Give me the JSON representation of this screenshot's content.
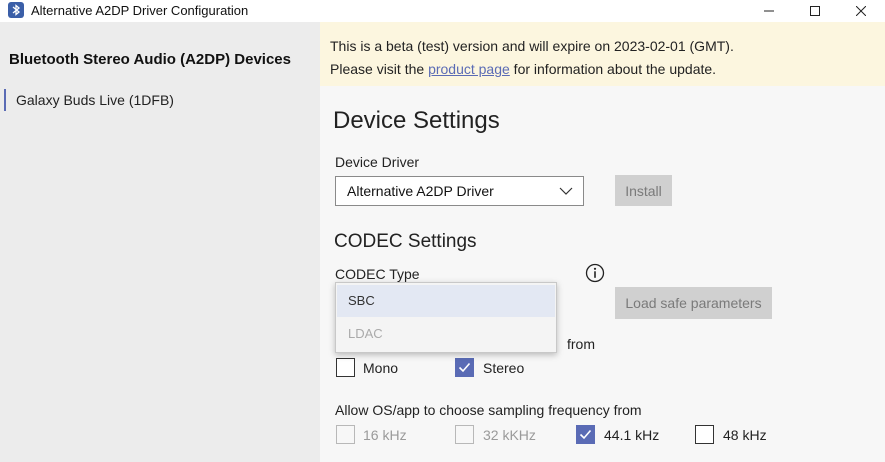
{
  "window": {
    "title": "Alternative A2DP Driver Configuration"
  },
  "sidebar": {
    "heading": "Bluetooth Stereo Audio (A2DP) Devices",
    "items": [
      {
        "label": "Galaxy Buds Live (1DFB)",
        "selected": true
      }
    ]
  },
  "banner": {
    "line1": "This is a beta (test) version and will expire on 2023-02-01 (GMT).",
    "line2_prefix": "Please visit the ",
    "line2_link": "product page",
    "line2_suffix": " for information about the update."
  },
  "device_settings": {
    "heading": "Device Settings",
    "driver_label": "Device Driver",
    "driver_value": "Alternative A2DP Driver",
    "install_label": "Install"
  },
  "codec_settings": {
    "heading": "CODEC Settings",
    "codec_type_label": "CODEC Type",
    "codec_options": [
      "SBC",
      "LDAC"
    ],
    "codec_option_enabled": [
      true,
      false
    ],
    "load_safe_label": "Load safe parameters",
    "channel_label_suffix": "from",
    "channel_modes": [
      {
        "label": "Mono",
        "checked": false
      },
      {
        "label": "Stereo",
        "checked": true
      }
    ],
    "frequency_label": "Allow OS/app to choose sampling frequency from",
    "frequencies": [
      {
        "label": "16 kHz",
        "checked": false,
        "enabled": false
      },
      {
        "label": "32 kKHz",
        "checked": false,
        "enabled": false
      },
      {
        "label": "44.1 kHz",
        "checked": true,
        "enabled": true
      },
      {
        "label": "48 kHz",
        "checked": false,
        "enabled": true
      }
    ]
  },
  "colors": {
    "accent": "#5a6bb5",
    "banner_bg": "#fcf6df",
    "sidebar_bg": "#ececec",
    "disabled_button_bg": "#d0d0d0"
  },
  "icons": {
    "app": "bluetooth-app-icon",
    "info": "info-icon",
    "chevron": "chevron-down-icon",
    "check": "checkmark-icon"
  }
}
